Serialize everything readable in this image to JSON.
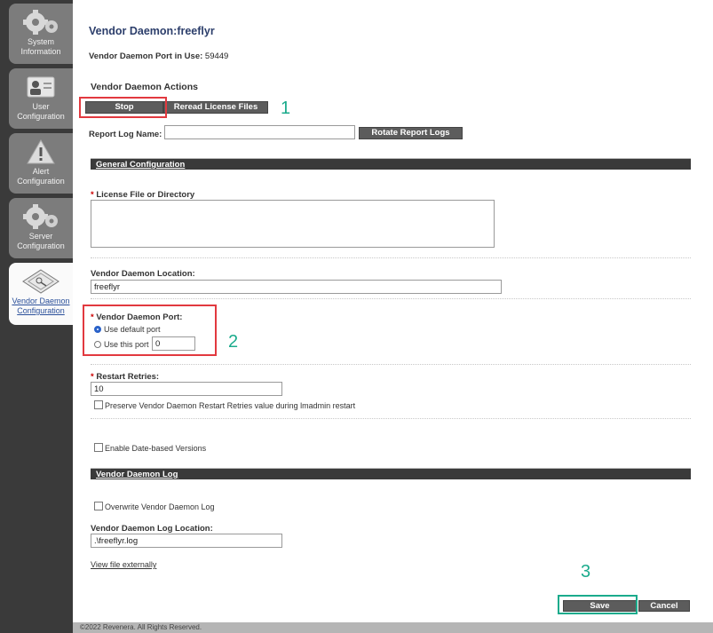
{
  "sidebar": {
    "tabs": [
      {
        "line1": "System",
        "line2": "Information",
        "icon": "gears-icon"
      },
      {
        "line1": "User",
        "line2": "Configuration",
        "icon": "user-id-icon"
      },
      {
        "line1": "Alert",
        "line2": "Configuration",
        "icon": "warning-icon"
      },
      {
        "line1": "Server",
        "line2": "Configuration",
        "icon": "gears-icon"
      },
      {
        "line1": "Vendor Daemon",
        "line2": "Configuration",
        "icon": "certificate-icon",
        "active": true
      }
    ]
  },
  "header": {
    "title": "Vendor Daemon:freeflyr",
    "port_label": "Vendor Daemon Port in Use:",
    "port_value": "59449"
  },
  "actions": {
    "heading": "Vendor Daemon Actions",
    "stop_label": "Stop",
    "reread_label": "Reread License Files",
    "report_log_label": "Report Log Name:",
    "report_log_value": "",
    "rotate_label": "Rotate Report Logs"
  },
  "general": {
    "bar_title": "General Configuration",
    "license_label": "License File or Directory",
    "license_value": "",
    "location_label": "Vendor Daemon Location:",
    "location_value": "freeflyr",
    "port_label": "Vendor Daemon Port:",
    "default_port_label": "Use default port",
    "this_port_label": "Use this port",
    "this_port_value": "0",
    "retries_label": "Restart Retries:",
    "retries_value": "10",
    "preserve_label": "Preserve Vendor Daemon Restart Retries value during lmadmin restart",
    "date_versions_label": "Enable Date-based Versions"
  },
  "log": {
    "bar_title": "Vendor Daemon Log",
    "overwrite_label": "Overwrite Vendor Daemon Log",
    "location_label": "Vendor Daemon Log Location:",
    "location_value": ".\\freeflyr.log",
    "view_link": "View file externally"
  },
  "buttons": {
    "save_label": "Save",
    "cancel_label": "Cancel"
  },
  "annotations": {
    "n1": "1",
    "n2": "2",
    "n3": "3",
    "box_color": "#e2393f",
    "teal_color": "#1bab8c"
  },
  "footer": {
    "text": "©2022 Revenera. All Rights Reserved."
  }
}
